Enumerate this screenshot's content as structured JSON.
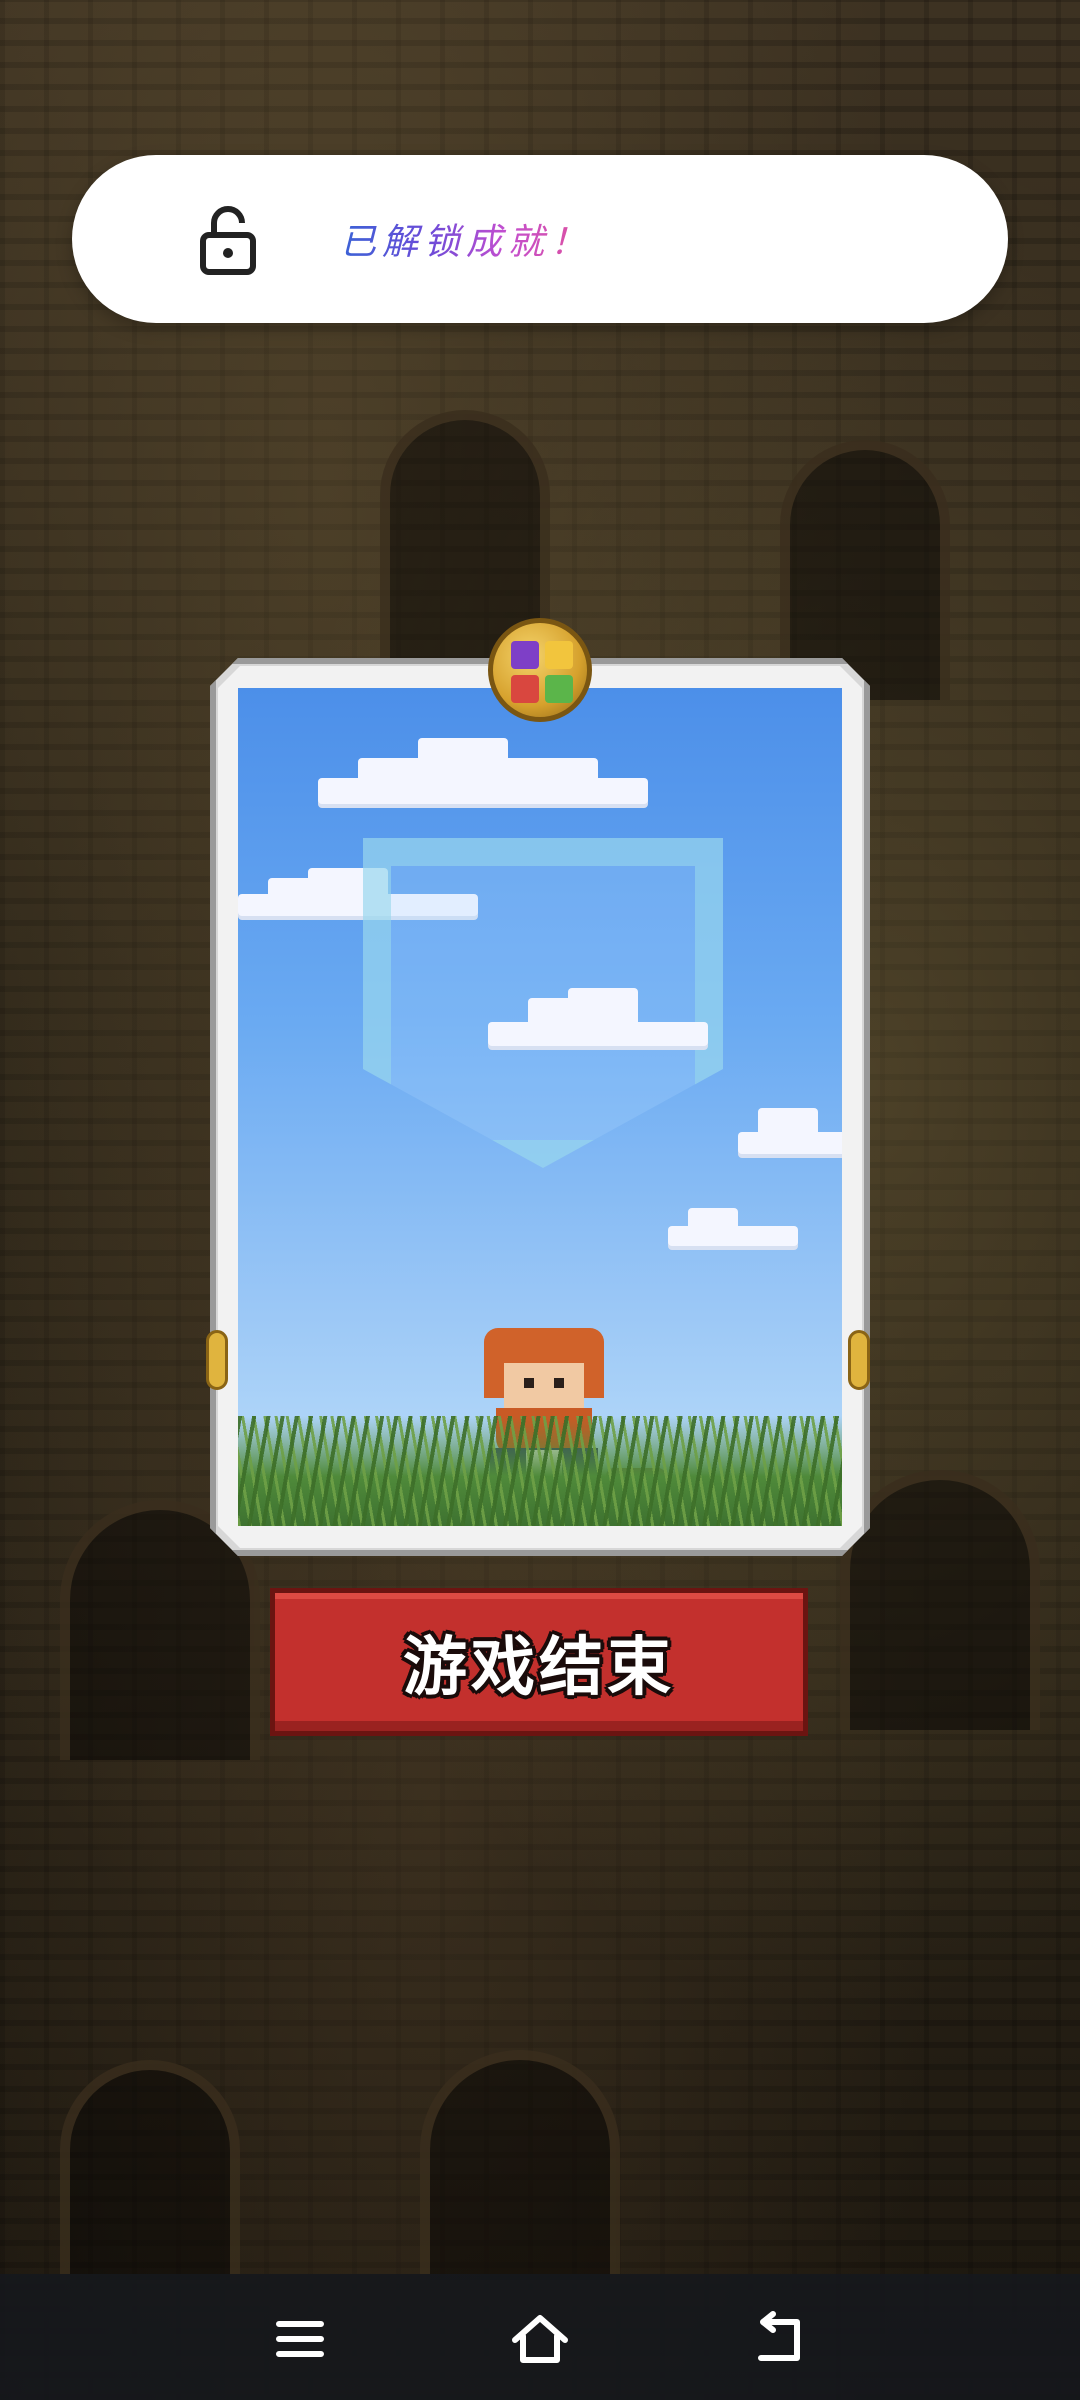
{
  "toast": {
    "icon": "unlocked-padlock-icon",
    "message": "已解锁成就！"
  },
  "card": {
    "emblem_icon": "four-color-emblem-icon",
    "art": "hero-on-grassland-with-shield"
  },
  "game_over_button": {
    "label": "游戏结束",
    "color": "#c3302d"
  },
  "navbar": {
    "menu_icon": "menu-icon",
    "home_icon": "home-icon",
    "back_icon": "back-icon"
  }
}
